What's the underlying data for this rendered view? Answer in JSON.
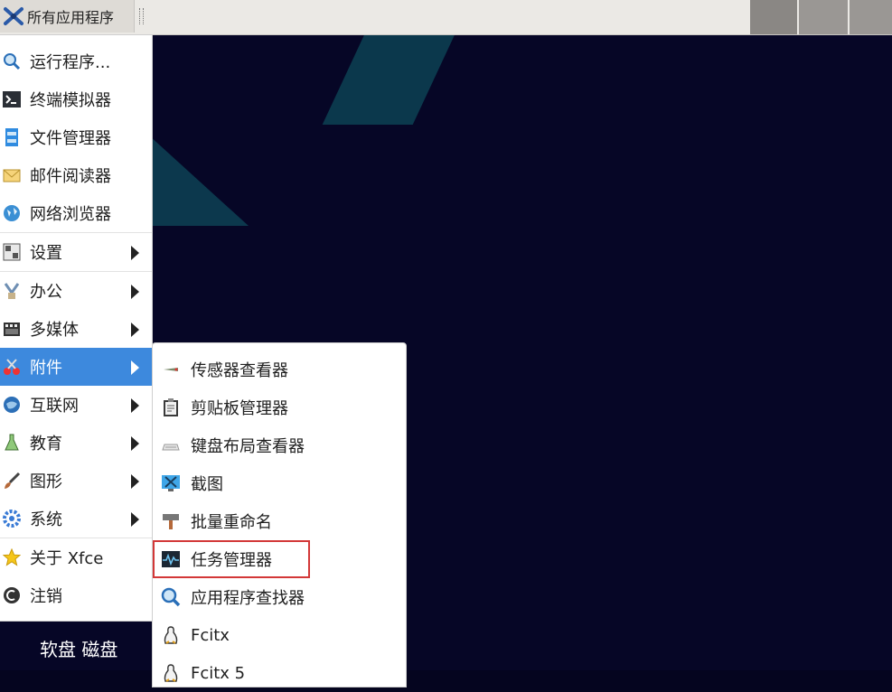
{
  "panel": {
    "apps_menu_label": "所有应用程序",
    "apps_menu_icon": "xfce-logo-icon"
  },
  "menu": {
    "items": [
      {
        "label": "运行程序...",
        "icon": "search-icon",
        "submenu": false
      },
      {
        "label": "终端模拟器",
        "icon": "terminal-icon",
        "submenu": false
      },
      {
        "label": "文件管理器",
        "icon": "file-manager-icon",
        "submenu": false
      },
      {
        "label": "邮件阅读器",
        "icon": "mail-icon",
        "submenu": false
      },
      {
        "label": "网络浏览器",
        "icon": "globe-icon",
        "submenu": false
      },
      {
        "label": "设置",
        "icon": "settings-icon",
        "submenu": true
      },
      {
        "label": "办公",
        "icon": "office-icon",
        "submenu": true
      },
      {
        "label": "多媒体",
        "icon": "multimedia-icon",
        "submenu": true
      },
      {
        "label": "附件",
        "icon": "accessories-icon",
        "submenu": true,
        "active": true
      },
      {
        "label": "互联网",
        "icon": "internet-icon",
        "submenu": true
      },
      {
        "label": "教育",
        "icon": "education-icon",
        "submenu": true
      },
      {
        "label": "图形",
        "icon": "graphics-icon",
        "submenu": true
      },
      {
        "label": "系统",
        "icon": "system-icon",
        "submenu": true
      },
      {
        "label": "关于 Xfce",
        "icon": "star-icon",
        "submenu": false
      },
      {
        "label": "注销",
        "icon": "logout-icon",
        "submenu": false
      }
    ]
  },
  "submenu": {
    "items": [
      {
        "label": "传感器查看器",
        "icon": "sensor-icon"
      },
      {
        "label": "剪贴板管理器",
        "icon": "clipboard-icon"
      },
      {
        "label": "键盘布局查看器",
        "icon": "keyboard-icon"
      },
      {
        "label": "截图",
        "icon": "screenshot-icon"
      },
      {
        "label": "批量重命名",
        "icon": "rename-icon"
      },
      {
        "label": "任务管理器",
        "icon": "task-manager-icon",
        "highlighted": true
      },
      {
        "label": "应用程序查找器",
        "icon": "app-finder-icon"
      },
      {
        "label": "Fcitx",
        "icon": "fcitx-icon"
      },
      {
        "label": "Fcitx 5",
        "icon": "fcitx5-icon"
      }
    ]
  },
  "desktop": {
    "label": "软盘 磁盘"
  },
  "colors": {
    "menu_active": "#3d89dd",
    "highlight_box": "#d33838",
    "desktop_bg": "#060626"
  }
}
